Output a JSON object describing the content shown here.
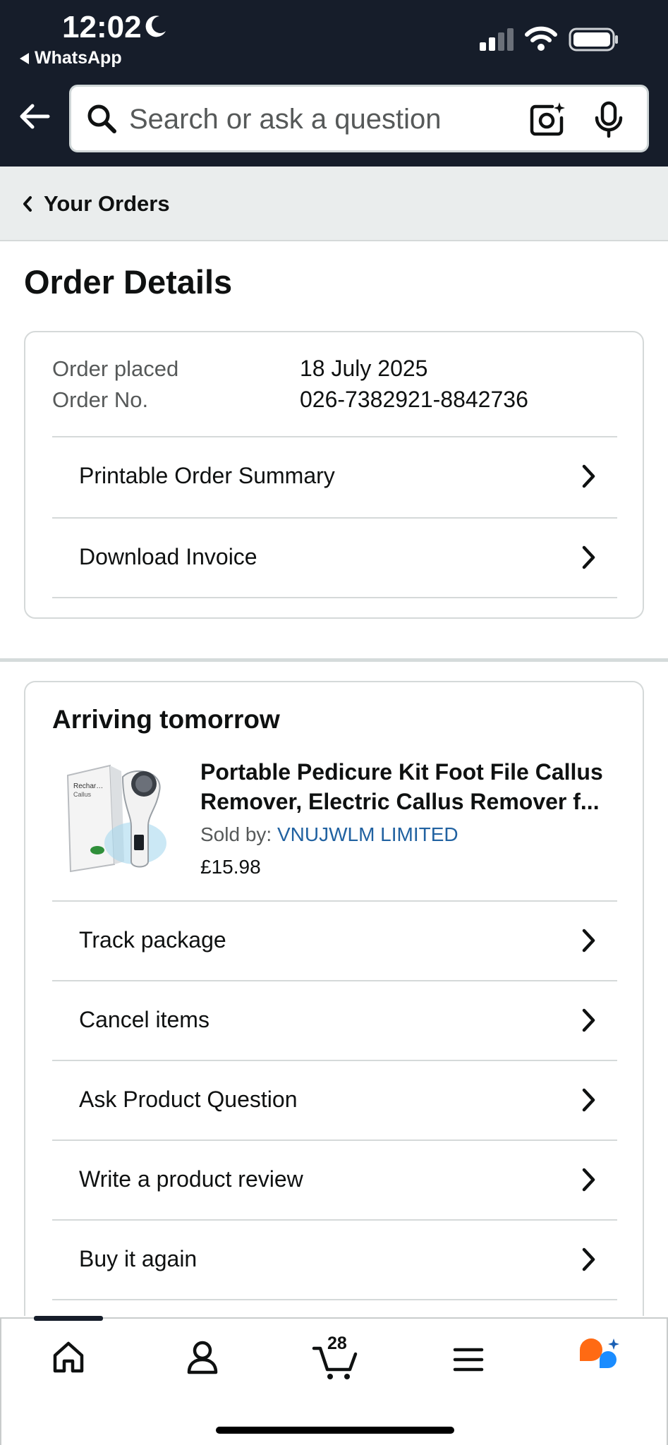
{
  "status_bar": {
    "time": "12:02",
    "back_app": "WhatsApp"
  },
  "search": {
    "placeholder": "Search or ask a question"
  },
  "breadcrumb": {
    "label": "Your Orders"
  },
  "page": {
    "title": "Order Details"
  },
  "order_info": {
    "placed_label": "Order placed",
    "placed_value": "18 July 2025",
    "number_label": "Order No.",
    "number_value": "026-7382921-8842736",
    "actions": [
      {
        "label": "Printable Order Summary"
      },
      {
        "label": "Download Invoice"
      }
    ]
  },
  "shipment": {
    "status": "Arriving tomorrow",
    "product": {
      "title": "Portable Pedicure Kit Foot File Callus Remover, Electric Callus Remover f...",
      "sold_by_label": "Sold by:",
      "seller": "VNUJWLM LIMITED",
      "price": "£15.98",
      "image_text": "Rechargeable Callus Remover"
    },
    "actions": [
      {
        "label": "Track package"
      },
      {
        "label": "Cancel items"
      },
      {
        "label": "Ask Product Question"
      },
      {
        "label": "Write a product review"
      },
      {
        "label": "Buy it again"
      }
    ]
  },
  "bottom_nav": {
    "cart_count": "28",
    "items": [
      "home-icon",
      "account-icon",
      "cart-icon",
      "menu-icon",
      "rufus-assistant-icon"
    ]
  },
  "colors": {
    "header_bg": "#161d2a",
    "link": "#2162a1",
    "rufus_orange": "#ff6a13",
    "rufus_blue": "#1a8cff"
  }
}
